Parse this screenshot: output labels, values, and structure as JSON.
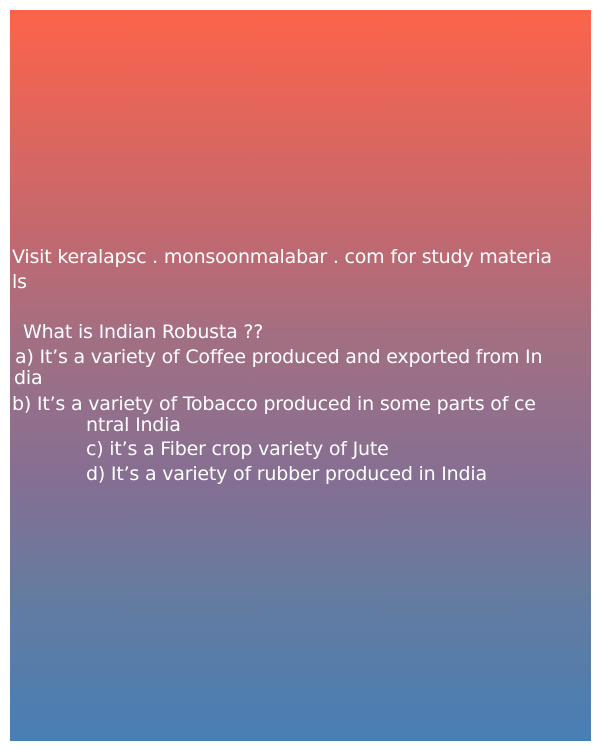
{
  "promo": {
    "line1": "Visit keralapsc . monsoonmalabar . com for study materia",
    "line2": "ls"
  },
  "question": {
    "title": "What is Indian Robusta ??",
    "option_a_line1": "a) It’s a variety of Coffee produced and exported from In",
    "option_a_line2": "dia",
    "option_b_line1": "b) It’s a variety of Tobacco produced in some parts of ce",
    "option_b_line2": "ntral India",
    "option_c": "c) it’s a Fiber crop variety of Jute",
    "option_d": "d) It’s a variety of rubber produced in India"
  }
}
